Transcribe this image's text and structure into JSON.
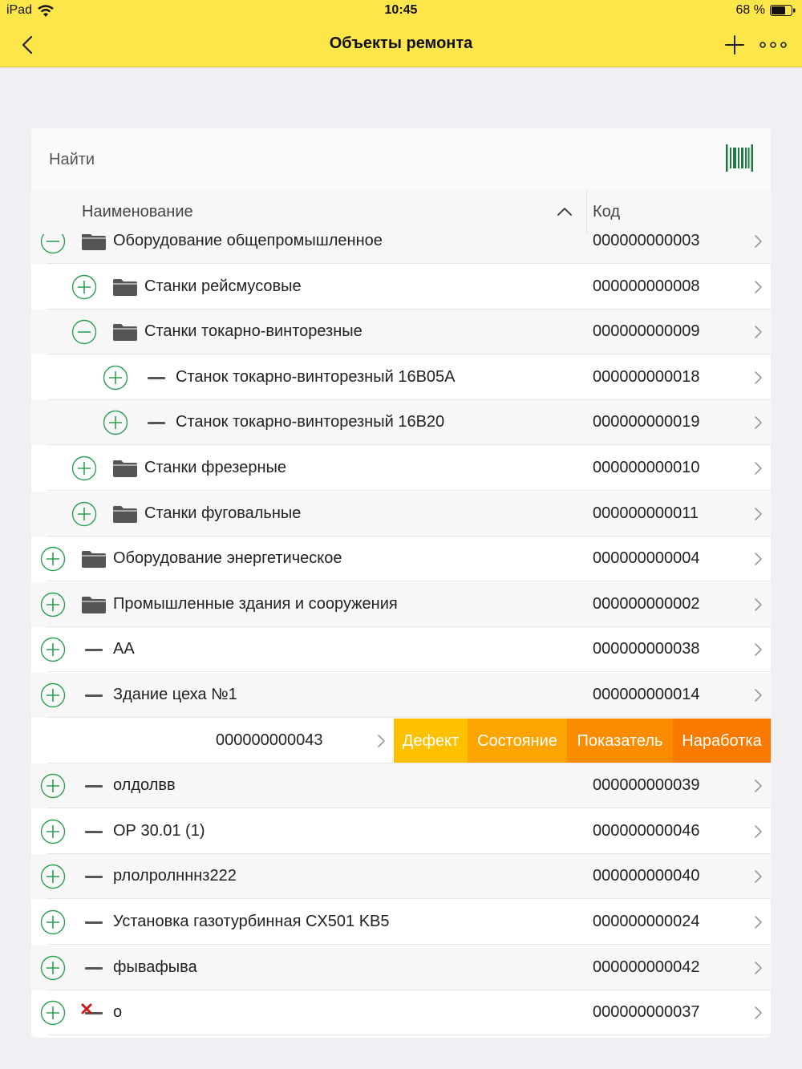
{
  "status_bar": {
    "carrier": "iPad",
    "time": "10:45",
    "battery": "68 %"
  },
  "nav": {
    "title": "Объекты ремонта"
  },
  "search": {
    "placeholder": "Найти"
  },
  "table": {
    "col_name": "Наименование",
    "col_code": "Код",
    "rows": [
      {
        "label": "Оборудование общепромышленное",
        "code": "000000000003",
        "level": 0,
        "toggle": "minus",
        "type": "folder"
      },
      {
        "label": "Станки рейсмусовые",
        "code": "000000000008",
        "level": 1,
        "toggle": "plus",
        "type": "folder"
      },
      {
        "label": "Станки токарно-винторезные",
        "code": "000000000009",
        "level": 1,
        "toggle": "minus",
        "type": "folder"
      },
      {
        "label": "Станок токарно-винторезный 16В05А",
        "code": "000000000018",
        "level": 2,
        "toggle": "plus",
        "type": "item"
      },
      {
        "label": "Станок токарно-винторезный 16В20",
        "code": "000000000019",
        "level": 2,
        "toggle": "plus",
        "type": "item"
      },
      {
        "label": "Станки фрезерные",
        "code": "000000000010",
        "level": 1,
        "toggle": "plus",
        "type": "folder"
      },
      {
        "label": "Станки фуговальные",
        "code": "000000000011",
        "level": 1,
        "toggle": "plus",
        "type": "folder"
      },
      {
        "label": "Оборудование энергетическое",
        "code": "000000000004",
        "level": 0,
        "toggle": "plus",
        "type": "folder"
      },
      {
        "label": "Промышленные здания и сооружения",
        "code": "000000000002",
        "level": 0,
        "toggle": "plus",
        "type": "folder"
      },
      {
        "label": "АА",
        "code": "000000000038",
        "level": 0,
        "toggle": "plus",
        "type": "item"
      },
      {
        "label": "Здание цеха №1",
        "code": "000000000014",
        "level": 0,
        "toggle": "plus",
        "type": "item"
      },
      {
        "swiped": true,
        "code": "000000000043"
      },
      {
        "label": "олдолвв",
        "code": "000000000039",
        "level": 0,
        "toggle": "plus",
        "type": "item"
      },
      {
        "label": "ОР 30.01 (1)",
        "code": "000000000046",
        "level": 0,
        "toggle": "plus",
        "type": "item"
      },
      {
        "label": "рлолролнннз222",
        "code": "000000000040",
        "level": 0,
        "toggle": "plus",
        "type": "item"
      },
      {
        "label": "Установка газотурбинная CX501 KB5",
        "code": "000000000024",
        "level": 0,
        "toggle": "plus",
        "type": "item"
      },
      {
        "label": "фывафыва",
        "code": "000000000042",
        "level": 0,
        "toggle": "plus",
        "type": "item"
      },
      {
        "label": "о",
        "code": "000000000037",
        "level": 0,
        "toggle": "plus",
        "type": "item-deleted"
      }
    ]
  },
  "swipe_actions": [
    {
      "label": "Дефект",
      "color": "#ffc000"
    },
    {
      "label": "Состояние",
      "color": "#fca500"
    },
    {
      "label": "Показатель",
      "color": "#fb8c00"
    },
    {
      "label": "Наработка",
      "color": "#f97a00"
    }
  ],
  "colors": {
    "accent_bar": "#fde64a",
    "toggle_green": "#2e9e52",
    "folder_gray": "#555555",
    "barcode_green": "#1e7a3c",
    "delete_mark": "#d01818"
  },
  "icons": {
    "back": "chevron-left-icon",
    "add": "plus-icon",
    "more": "more-icon",
    "barcode": "barcode-icon",
    "sort": "chevron-up-icon"
  }
}
